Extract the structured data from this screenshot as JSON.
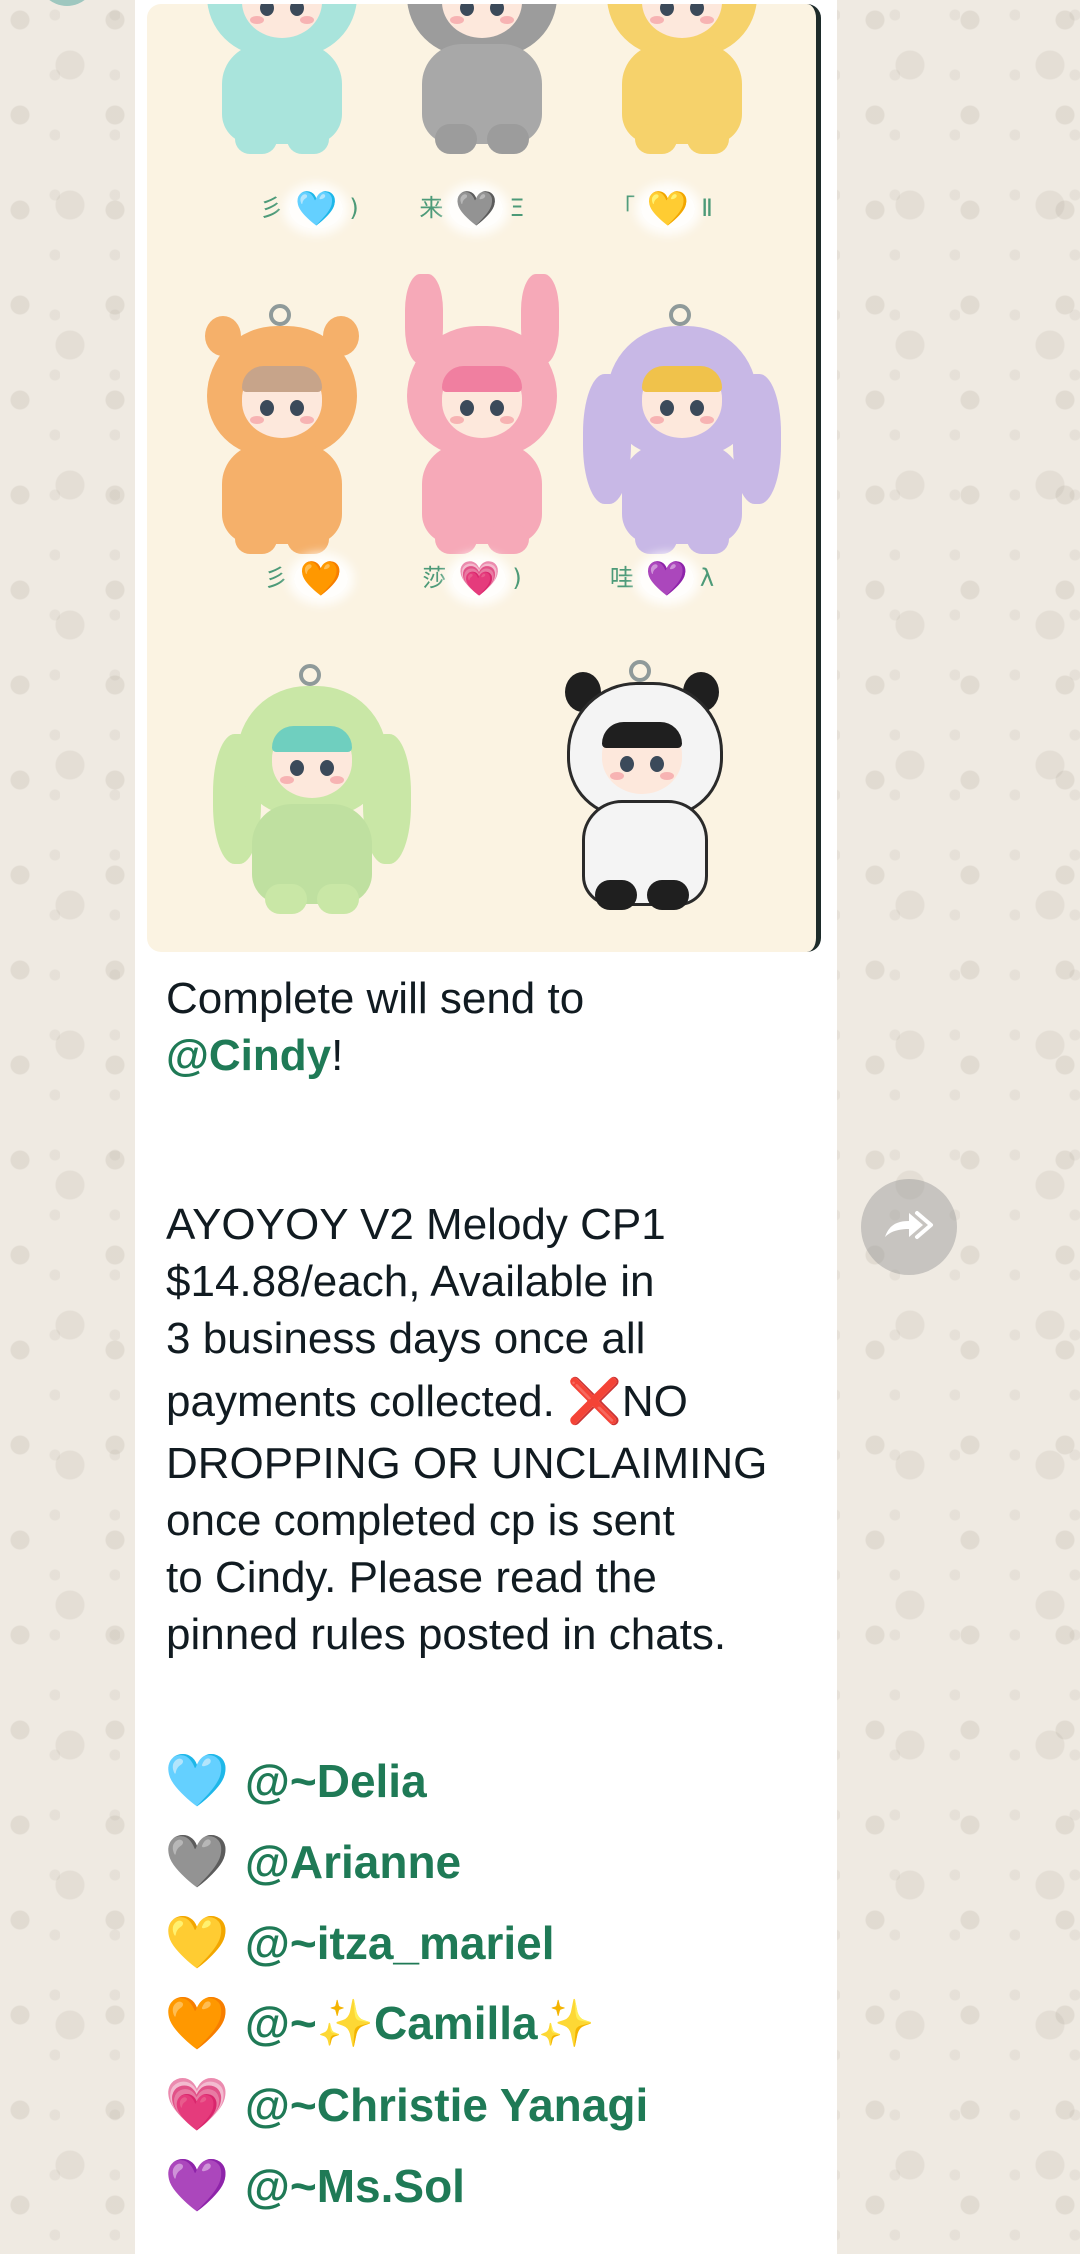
{
  "message": {
    "caption": {
      "prefix": "Complete will send to",
      "mention": "@Cindy",
      "suffix": "!"
    },
    "body_lines": [
      "AYOYOY V2 Melody CP1",
      "$14.88/each, Available in",
      "3 business days once all",
      "payments collected. ",
      "DROPPING OR UNCLAIMING",
      "once completed cp is sent",
      "to Cindy. Please read the",
      "pinned rules posted in chats."
    ],
    "no_emoji": "❌",
    "no_text": "NO",
    "claims": [
      {
        "emoji": "🩵",
        "name": "@~Delia"
      },
      {
        "emoji": "🩶",
        "name": "@Arianne"
      },
      {
        "emoji": "💛",
        "name": "@~itza_mariel"
      },
      {
        "emoji": "🧡",
        "name": "@~✨Camilla✨"
      },
      {
        "emoji": "💗",
        "name": "@~Christie Yanagi"
      },
      {
        "emoji": "💜",
        "name": "@~Ms.Sol"
      }
    ]
  },
  "image_tags": [
    {
      "left": "彡",
      "heart": "🩵",
      "right": ")"
    },
    {
      "left": "来",
      "heart": "🩶",
      "right": "Ξ"
    },
    {
      "left": "「",
      "heart": "💛",
      "right": "Ⅱ"
    },
    {
      "left": "彡",
      "heart": "🧡",
      "right": ""
    },
    {
      "left": "莎",
      "heart": "💗",
      "right": ")"
    },
    {
      "left": "哇",
      "heart": "💜",
      "right": "λ"
    }
  ],
  "colors": {
    "mention": "#1f7a56",
    "bubble": "#ffffff",
    "wallpaper": "#efeae2"
  },
  "icons": {
    "forward": "forward-arrow-icon"
  }
}
